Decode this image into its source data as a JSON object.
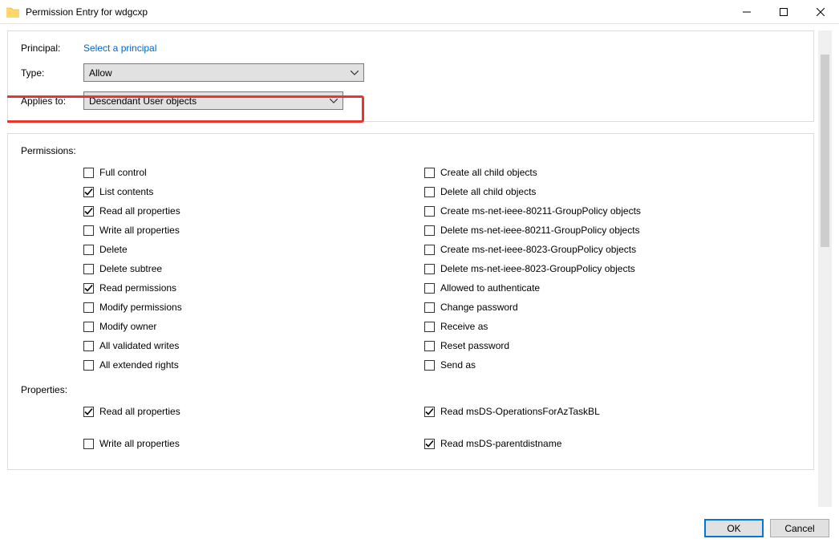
{
  "window": {
    "title": "Permission Entry for wdgcxp"
  },
  "top": {
    "principal_label": "Principal:",
    "principal_link": "Select a principal",
    "type_label": "Type:",
    "type_value": "Allow",
    "applies_label": "Applies to:",
    "applies_value": "Descendant User objects"
  },
  "permissions": {
    "section_label": "Permissions:",
    "left": [
      {
        "label": "Full control",
        "checked": false
      },
      {
        "label": "List contents",
        "checked": true
      },
      {
        "label": "Read all properties",
        "checked": true
      },
      {
        "label": "Write all properties",
        "checked": false
      },
      {
        "label": "Delete",
        "checked": false
      },
      {
        "label": "Delete subtree",
        "checked": false
      },
      {
        "label": "Read permissions",
        "checked": true
      },
      {
        "label": "Modify permissions",
        "checked": false
      },
      {
        "label": "Modify owner",
        "checked": false
      },
      {
        "label": "All validated writes",
        "checked": false
      },
      {
        "label": "All extended rights",
        "checked": false
      }
    ],
    "right": [
      {
        "label": "Create all child objects",
        "checked": false
      },
      {
        "label": "Delete all child objects",
        "checked": false
      },
      {
        "label": "Create ms-net-ieee-80211-GroupPolicy objects",
        "checked": false
      },
      {
        "label": "Delete ms-net-ieee-80211-GroupPolicy objects",
        "checked": false
      },
      {
        "label": "Create ms-net-ieee-8023-GroupPolicy objects",
        "checked": false
      },
      {
        "label": "Delete ms-net-ieee-8023-GroupPolicy objects",
        "checked": false
      },
      {
        "label": "Allowed to authenticate",
        "checked": false
      },
      {
        "label": "Change password",
        "checked": false
      },
      {
        "label": "Receive as",
        "checked": false
      },
      {
        "label": "Reset password",
        "checked": false
      },
      {
        "label": "Send as",
        "checked": false
      }
    ]
  },
  "properties": {
    "section_label": "Properties:",
    "left": [
      {
        "label": "Read all properties",
        "checked": true
      },
      {
        "label": "Write all properties",
        "checked": false
      }
    ],
    "right": [
      {
        "label": "Read msDS-OperationsForAzTaskBL",
        "checked": true
      },
      {
        "label": "Read msDS-parentdistname",
        "checked": true
      }
    ]
  },
  "footer": {
    "ok": "OK",
    "cancel": "Cancel"
  }
}
